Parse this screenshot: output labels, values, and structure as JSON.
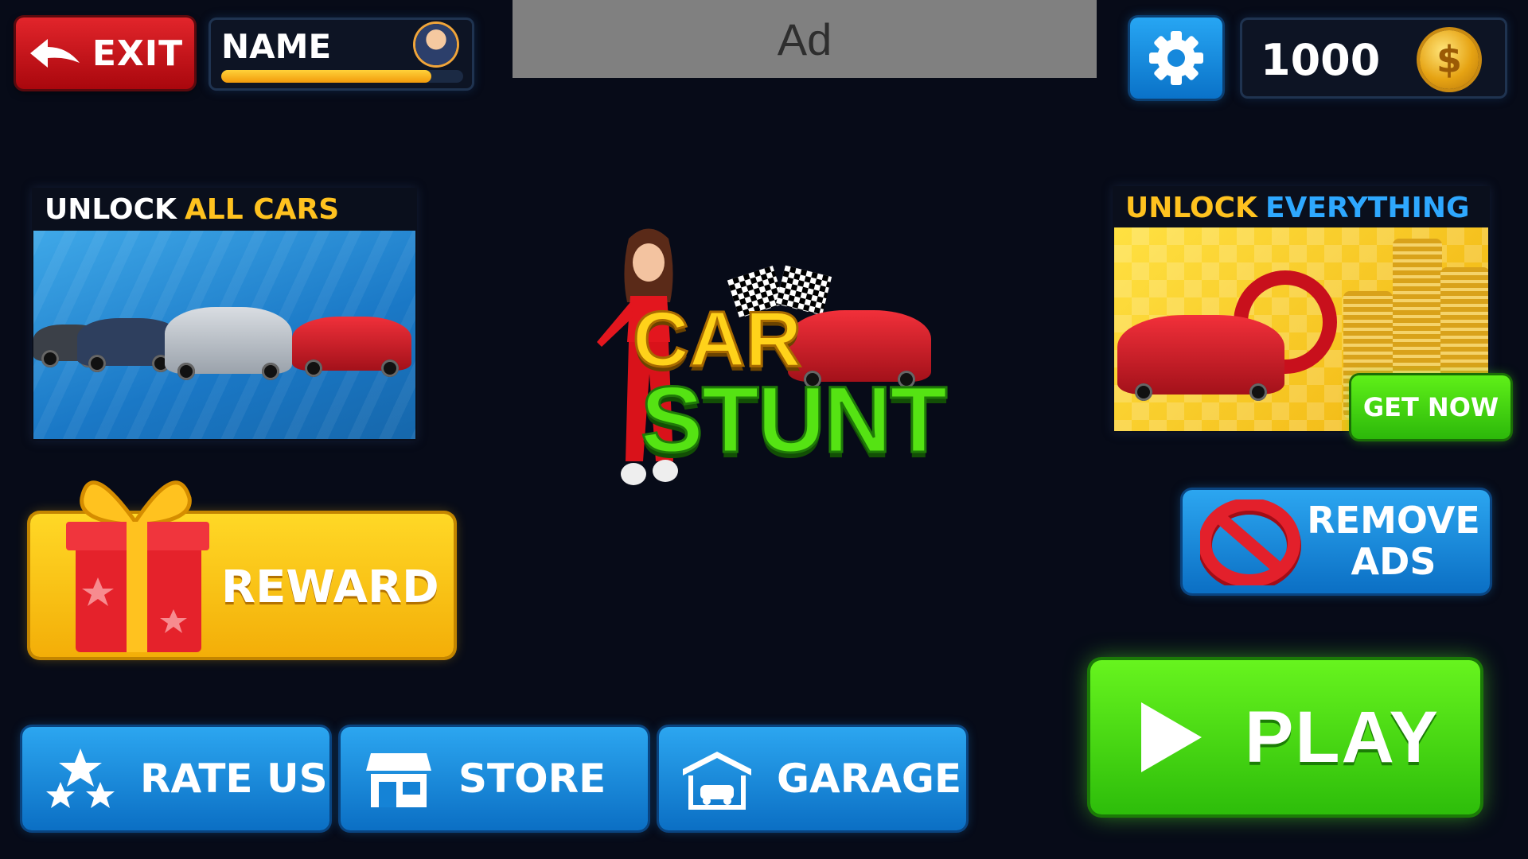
{
  "top_bar": {
    "exit_label": "EXIT",
    "name_label": "NAME",
    "xp_progress": 0.87,
    "ad_label": "Ad",
    "coins": "1000"
  },
  "promo_left": {
    "title_white": "UNLOCK",
    "title_accent": "ALL CARS"
  },
  "promo_right": {
    "title_yellow": "UNLOCK",
    "title_accent": "EVERYTHING",
    "cta_label": "GET NOW"
  },
  "logo": {
    "line1": "CAR",
    "line2": "STUNT"
  },
  "buttons": {
    "reward_label": "REWARD",
    "remove_ads_line1": "REMOVE",
    "remove_ads_line2": "ADS",
    "rate_us_label": "RATE US",
    "store_label": "STORE",
    "garage_label": "GARAGE",
    "play_label": "PLAY"
  },
  "colors": {
    "background": "#070b18",
    "exit_red": "#c8141b",
    "accent_yellow": "#ffc21f",
    "accent_blue": "#2ea8ff",
    "play_green": "#4cdc14"
  },
  "icons": {
    "exit": "back-arrow-icon",
    "avatar": "avatar-icon",
    "settings": "gear-icon",
    "coin": "coin-icon",
    "reward": "gift-icon",
    "remove_ads": "no-sign-icon",
    "rate_us": "stars-icon",
    "store": "store-icon",
    "garage": "garage-icon",
    "play": "play-icon"
  }
}
